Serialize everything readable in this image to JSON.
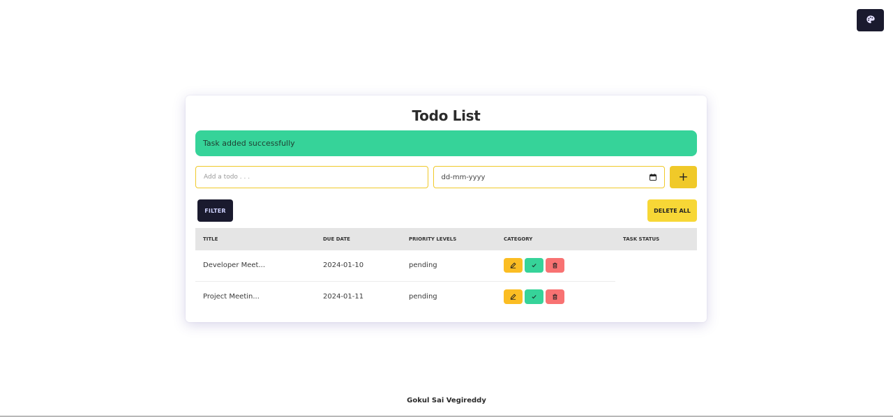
{
  "app": {
    "title": "Todo List",
    "theme_icon": "palette-icon"
  },
  "alert": {
    "message": "Task added successfully",
    "color": "#36d399"
  },
  "form": {
    "todo_placeholder": "Add a todo . . .",
    "todo_value": "",
    "date_placeholder": "dd-mm-yyyy",
    "date_icon": "calendar-icon",
    "add_label": "+"
  },
  "actions": {
    "filter_label": "FILTER",
    "delete_all_label": "DELETE ALL"
  },
  "table": {
    "columns": [
      "TITLE",
      "DUE DATE",
      "PRIORITY LEVELS",
      "CATEGORY",
      "TASK STATUS"
    ],
    "rows": [
      {
        "title": "Developer Meet...",
        "due_date": "2024-01-10",
        "priority": "pending"
      },
      {
        "title": "Project Meetin...",
        "due_date": "2024-01-11",
        "priority": "pending"
      }
    ],
    "row_actions": [
      "pencil-icon",
      "check-icon",
      "trash-icon"
    ]
  },
  "footer": {
    "author": "Gokul Sai Vegireddy"
  },
  "colors": {
    "accent_yellow": "#f0c929",
    "dark": "#1a1a2e",
    "success": "#36d399",
    "warning": "#fbbd23",
    "error": "#f87272"
  }
}
